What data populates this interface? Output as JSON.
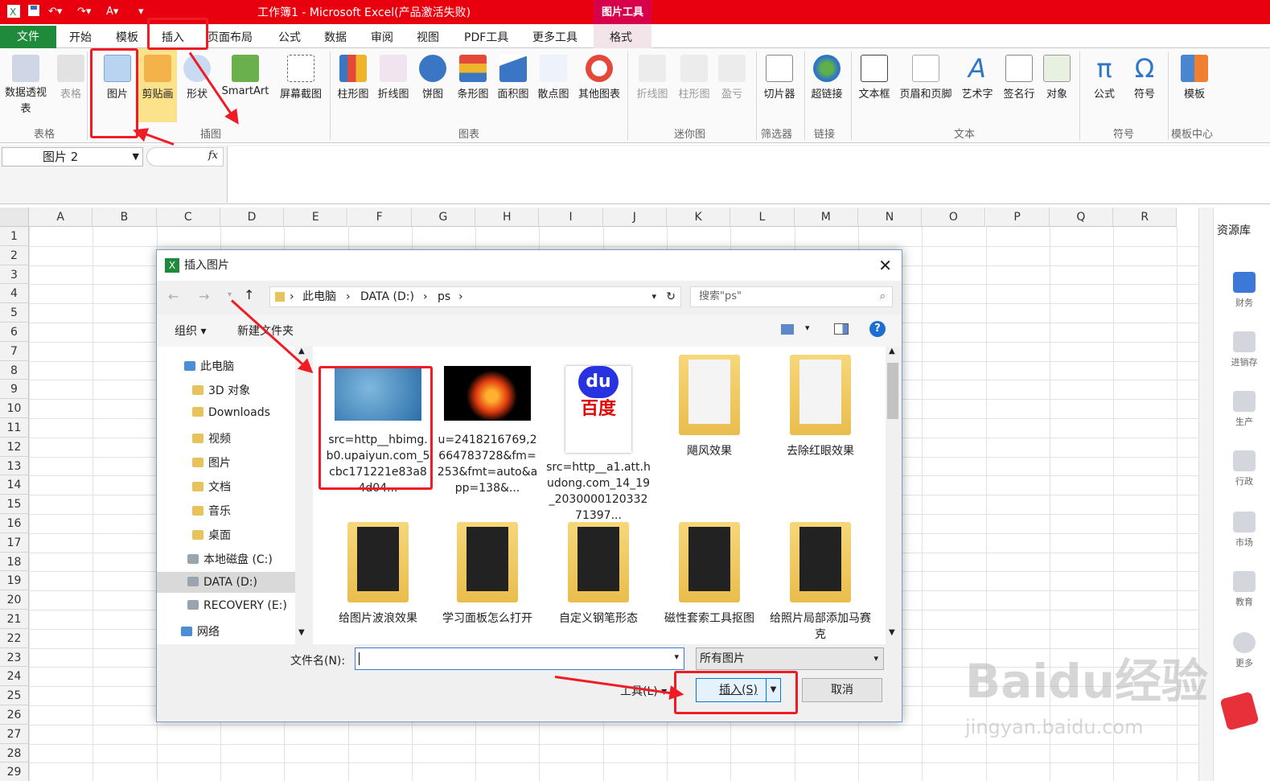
{
  "window": {
    "title": "工作簿1 - Microsoft Excel(产品激活失败)",
    "picture_tools": "图片工具"
  },
  "tabs": [
    "开始",
    "模板",
    "插入",
    "页面布局",
    "公式",
    "数据",
    "审阅",
    "视图",
    "PDF工具",
    "更多工具"
  ],
  "tab_file": "文件",
  "tab_format": "格式",
  "ribbon": {
    "buttons": [
      "数据透视表",
      "表格",
      "图片",
      "剪贴画",
      "形状",
      "SmartArt",
      "屏幕截图",
      "柱形图",
      "折线图",
      "饼图",
      "条形图",
      "面积图",
      "散点图",
      "其他图表",
      "折线图",
      "柱形图",
      "盈亏",
      "切片器",
      "超链接",
      "文本框",
      "页眉和页脚",
      "艺术字",
      "签名行",
      "对象",
      "公式",
      "符号",
      "模板"
    ],
    "groups": [
      "表格",
      "插图",
      "图表",
      "迷你图",
      "筛选器",
      "链接",
      "文本",
      "符号",
      "模板中心"
    ]
  },
  "formula_bar": {
    "name_box": "图片 2",
    "fx": "fx"
  },
  "columns": [
    "A",
    "B",
    "C",
    "D",
    "E",
    "F",
    "G",
    "H",
    "I",
    "J",
    "K",
    "L",
    "M",
    "N",
    "O",
    "P",
    "Q",
    "R"
  ],
  "rows": [
    "1",
    "2",
    "3",
    "4",
    "5",
    "6",
    "7",
    "8",
    "9",
    "10",
    "11",
    "12",
    "13",
    "14",
    "15",
    "16",
    "17",
    "18",
    "19",
    "20",
    "21",
    "22",
    "23",
    "24",
    "25",
    "26",
    "27",
    "28",
    "29"
  ],
  "right_panel": {
    "title": "资源库",
    "items": [
      "财务",
      "进销存",
      "生产",
      "行政",
      "市场",
      "教育",
      "更多"
    ]
  },
  "dialog": {
    "title": "插入图片",
    "path": [
      "此电脑",
      "DATA (D:)",
      "ps"
    ],
    "search_placeholder": "搜索\"ps\"",
    "organize": "组织",
    "new_folder": "新建文件夹",
    "nav": [
      "此电脑",
      "3D 对象",
      "Downloads",
      "视频",
      "图片",
      "文档",
      "音乐",
      "桌面",
      "本地磁盘 (C:)",
      "DATA (D:)",
      "RECOVERY (E:)",
      "网络"
    ],
    "files_row1": [
      {
        "name": "src=http__hbimg.b0.upaiyun.com_5cbc171221e83a84d04...",
        "kind": "ice"
      },
      {
        "name": "u=2418216769,2664783728&fm=253&fmt=auto&app=138&...",
        "kind": "fire"
      },
      {
        "name": "src=http__a1.att.hudong.com_14_19_203000012033271397...",
        "kind": "baidu"
      },
      {
        "name": "飓风效果",
        "kind": "folder"
      },
      {
        "name": "去除红眼效果",
        "kind": "folder"
      }
    ],
    "files_row2": [
      {
        "name": "给图片波浪效果",
        "kind": "folder"
      },
      {
        "name": "学习面板怎么打开",
        "kind": "folder"
      },
      {
        "name": "自定义钢笔形态",
        "kind": "folder"
      },
      {
        "name": "磁性套索工具抠图",
        "kind": "folder"
      },
      {
        "name": "给照片局部添加马赛克",
        "kind": "folder"
      }
    ],
    "filename_label": "文件名(N):",
    "filetype": "所有图片",
    "tools": "工具(L)",
    "insert": "插入(S)",
    "cancel": "取消"
  },
  "watermark": {
    "main": "Baidu经验",
    "sub": "jingyan.baidu.com"
  },
  "colors": {
    "title_red": "#e8000e",
    "file_green": "#1e8a3a",
    "annotation_red": "#ef1c25"
  }
}
